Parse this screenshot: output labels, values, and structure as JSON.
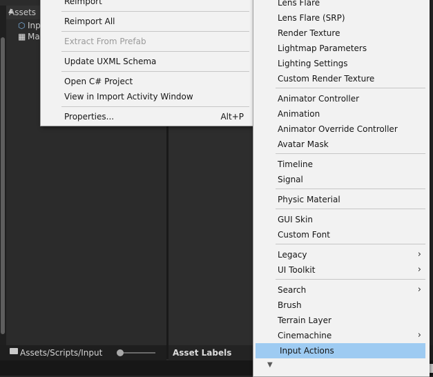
{
  "project_window": {
    "header_label": "Assets",
    "tree_items": [
      {
        "label": "Inp",
        "icon": "input-actions-asset-icon"
      },
      {
        "label": "Ma",
        "icon": "map-asset-icon"
      }
    ],
    "breadcrumb_path": "Assets/Scripts/Input"
  },
  "inspector": {
    "asset_labels_title": "Asset Labels"
  },
  "context_menu": {
    "items": [
      {
        "label": "Reimport",
        "shortcut": "",
        "disabled": false
      },
      {
        "label": "Reimport All",
        "shortcut": "",
        "disabled": false
      },
      {
        "label": "Extract From Prefab",
        "shortcut": "",
        "disabled": true
      },
      {
        "label": "Update UXML Schema",
        "shortcut": "",
        "disabled": false
      },
      {
        "label": "Open C# Project",
        "shortcut": "",
        "disabled": false
      },
      {
        "label": "View in Import Activity Window",
        "shortcut": "",
        "disabled": false
      },
      {
        "label": "Properties...",
        "shortcut": "Alt+P",
        "disabled": false
      }
    ]
  },
  "create_submenu": {
    "items": [
      {
        "label": "Lens Flare",
        "has_submenu": false
      },
      {
        "label": "Lens Flare (SRP)",
        "has_submenu": false
      },
      {
        "label": "Render Texture",
        "has_submenu": false
      },
      {
        "label": "Lightmap Parameters",
        "has_submenu": false
      },
      {
        "label": "Lighting Settings",
        "has_submenu": false
      },
      {
        "label": "Custom Render Texture",
        "has_submenu": false
      },
      {
        "label": "Animator Controller",
        "has_submenu": false
      },
      {
        "label": "Animation",
        "has_submenu": false
      },
      {
        "label": "Animator Override Controller",
        "has_submenu": false
      },
      {
        "label": "Avatar Mask",
        "has_submenu": false
      },
      {
        "label": "Timeline",
        "has_submenu": false
      },
      {
        "label": "Signal",
        "has_submenu": false
      },
      {
        "label": "Physic Material",
        "has_submenu": false
      },
      {
        "label": "GUI Skin",
        "has_submenu": false
      },
      {
        "label": "Custom Font",
        "has_submenu": false
      },
      {
        "label": "Legacy",
        "has_submenu": true
      },
      {
        "label": "UI Toolkit",
        "has_submenu": true
      },
      {
        "label": "Search",
        "has_submenu": true
      },
      {
        "label": "Brush",
        "has_submenu": false
      },
      {
        "label": "Terrain Layer",
        "has_submenu": false
      },
      {
        "label": "Cinemachine",
        "has_submenu": true
      },
      {
        "label": "Input Actions",
        "has_submenu": false,
        "highlighted": true
      }
    ],
    "highlight_color": "#9ecbf2",
    "scroll_indicator_icon": "scroll-down-arrow-icon"
  }
}
